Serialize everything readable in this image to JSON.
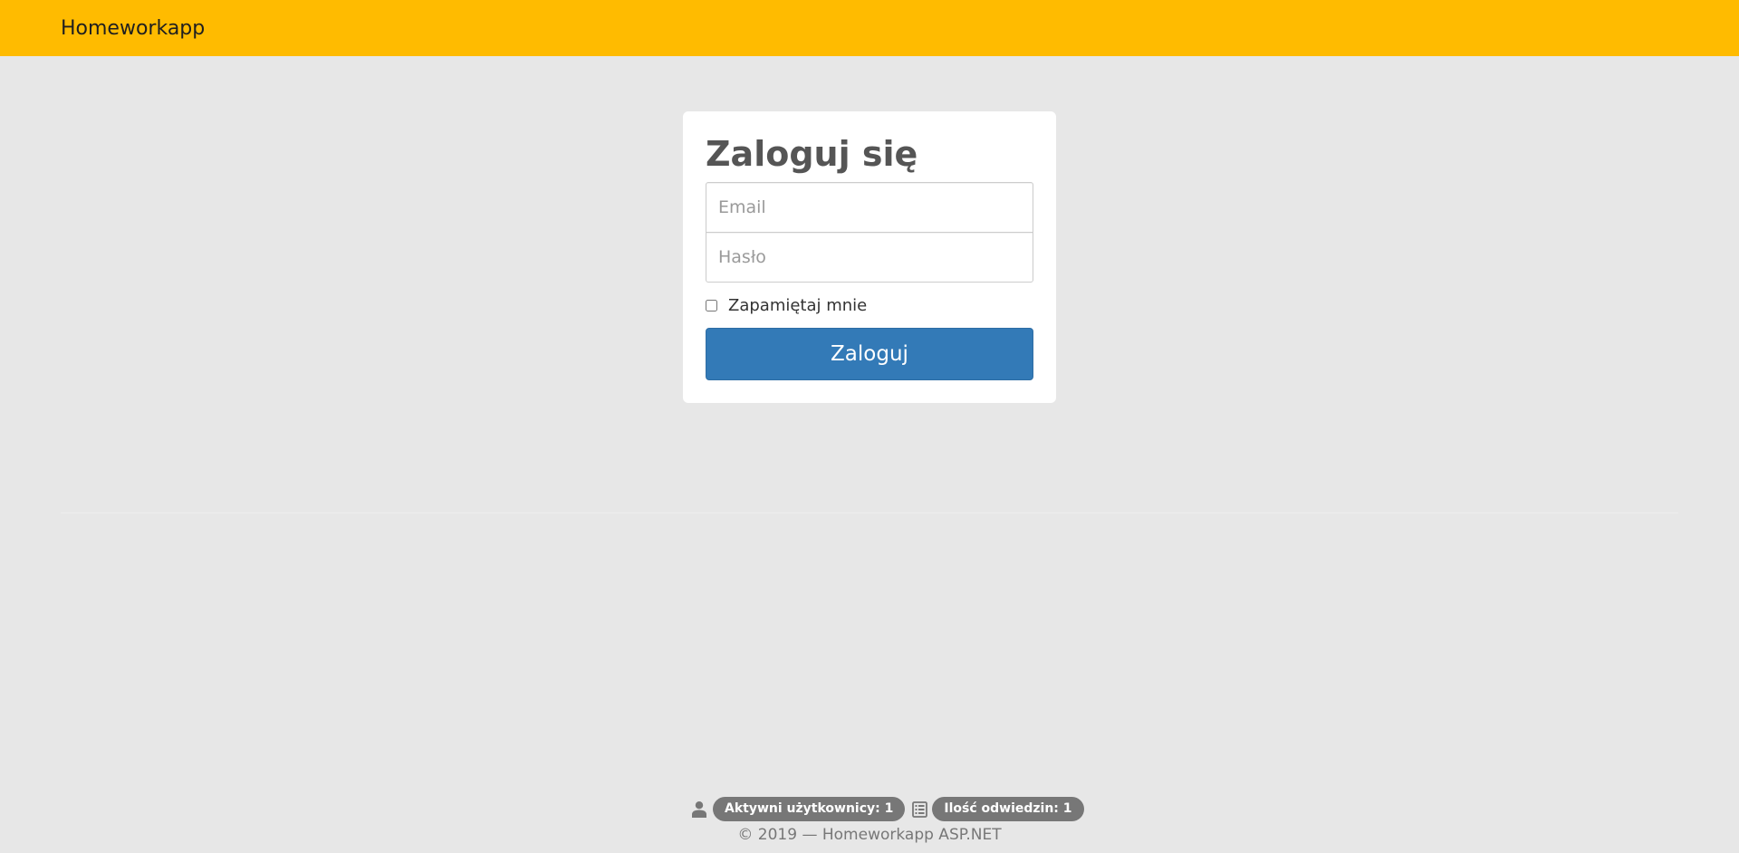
{
  "navbar": {
    "brand": "Homeworkapp",
    "background_color": "#ffbb00"
  },
  "login": {
    "title": "Zaloguj się",
    "email_placeholder": "Email",
    "password_placeholder": "Hasło",
    "remember_label": "Zapamiętaj mnie",
    "remember_checked": false,
    "submit_label": "Zaloguj",
    "submit_color": "#337ab7"
  },
  "footer": {
    "active_users": "Aktywni użytkownicy: 1",
    "visits": "Ilość odwiedzin: 1",
    "users_icon": "user-icon",
    "visits_icon": "list-alt-icon",
    "copyright": "© 2019 — Homeworkapp ASP.NET"
  }
}
